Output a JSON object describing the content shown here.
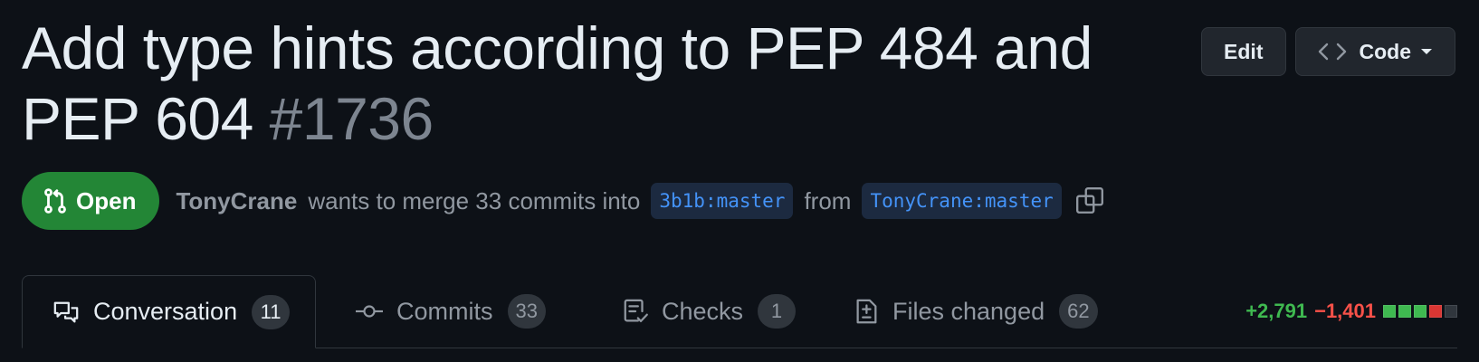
{
  "header": {
    "title": "Add type hints according to PEP 484 and PEP 604",
    "number": "#1736",
    "edit_label": "Edit",
    "code_label": "Code"
  },
  "state": {
    "label": "Open",
    "author": "TonyCrane",
    "merge_text": "wants to merge 33 commits into",
    "base_branch": "3b1b:master",
    "from_text": "from",
    "head_branch": "TonyCrane:master",
    "color": "#238636"
  },
  "tabs": [
    {
      "label": "Conversation",
      "count": "11",
      "icon": "comment-discussion-icon",
      "selected": true
    },
    {
      "label": "Commits",
      "count": "33",
      "icon": "git-commit-icon"
    },
    {
      "label": "Checks",
      "count": "1",
      "icon": "checklist-icon"
    },
    {
      "label": "Files changed",
      "count": "62",
      "icon": "file-diff-icon"
    }
  ],
  "diffstat": {
    "additions": "+2,791",
    "deletions": "−1,401",
    "blocks": [
      "added",
      "added",
      "added",
      "removed",
      "neutral"
    ],
    "colors": {
      "added": "#3fb950",
      "removed": "#da3633",
      "neutral": "#30363d"
    }
  }
}
